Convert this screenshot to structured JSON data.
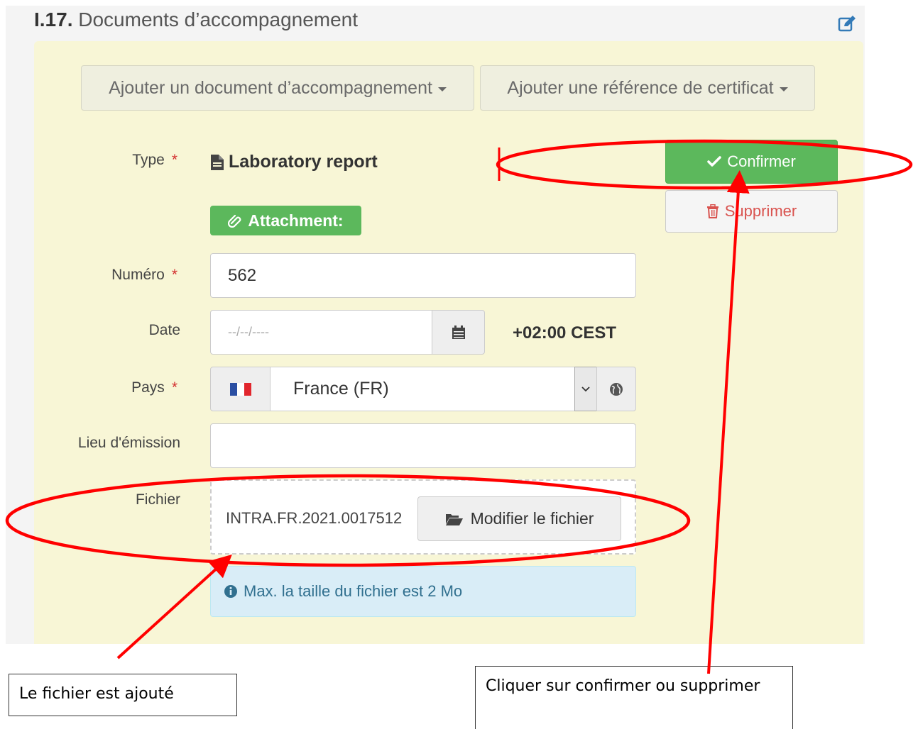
{
  "section": {
    "number": "I.17.",
    "title": "Documents d’accompagnement"
  },
  "dropdowns": {
    "add_document": "Ajouter un document d’accompagnement",
    "add_certificate_ref": "Ajouter une référence de certificat"
  },
  "form": {
    "type_label": "Type",
    "type_value": "Laboratory report",
    "required_mark": "*",
    "attachment_badge": "Attachment:",
    "number_label": "Numéro",
    "number_value": "562",
    "date_label": "Date",
    "date_placeholder": "--/--/----",
    "timezone": "+02:00 CEST",
    "country_label": "Pays",
    "country_value": "France (FR)",
    "place_label": "Lieu d'émission",
    "place_value": "",
    "file_label": "Fichier",
    "file_name": "INTRA.FR.2021.0017512",
    "modify_file_button": "Modifier le fichier",
    "info_text": "Max. la taille du fichier est 2 Mo"
  },
  "actions": {
    "confirm": "Confirmer",
    "delete": "Supprimer"
  },
  "annotations": {
    "left_callout": "Le fichier est ajouté",
    "right_callout": "Cliquer sur confirmer ou supprimer",
    "color": "#ff0000"
  },
  "colors": {
    "panel_bg": "#f8f6d6",
    "success": "#5cb85c",
    "danger": "#d9534f",
    "info_bg": "#d9edf7",
    "info_text": "#31708f",
    "edit_icon": "#337ab7"
  },
  "icons": {
    "edit": "edit-icon",
    "document": "file-text-icon",
    "paperclip": "paperclip-icon",
    "check": "check-icon",
    "trash": "trash-icon",
    "calendar": "calendar-icon",
    "flag": "france-flag-icon",
    "chevron": "chevron-down-icon",
    "globe": "globe-icon",
    "folder": "folder-open-icon",
    "info": "info-circle-icon"
  }
}
